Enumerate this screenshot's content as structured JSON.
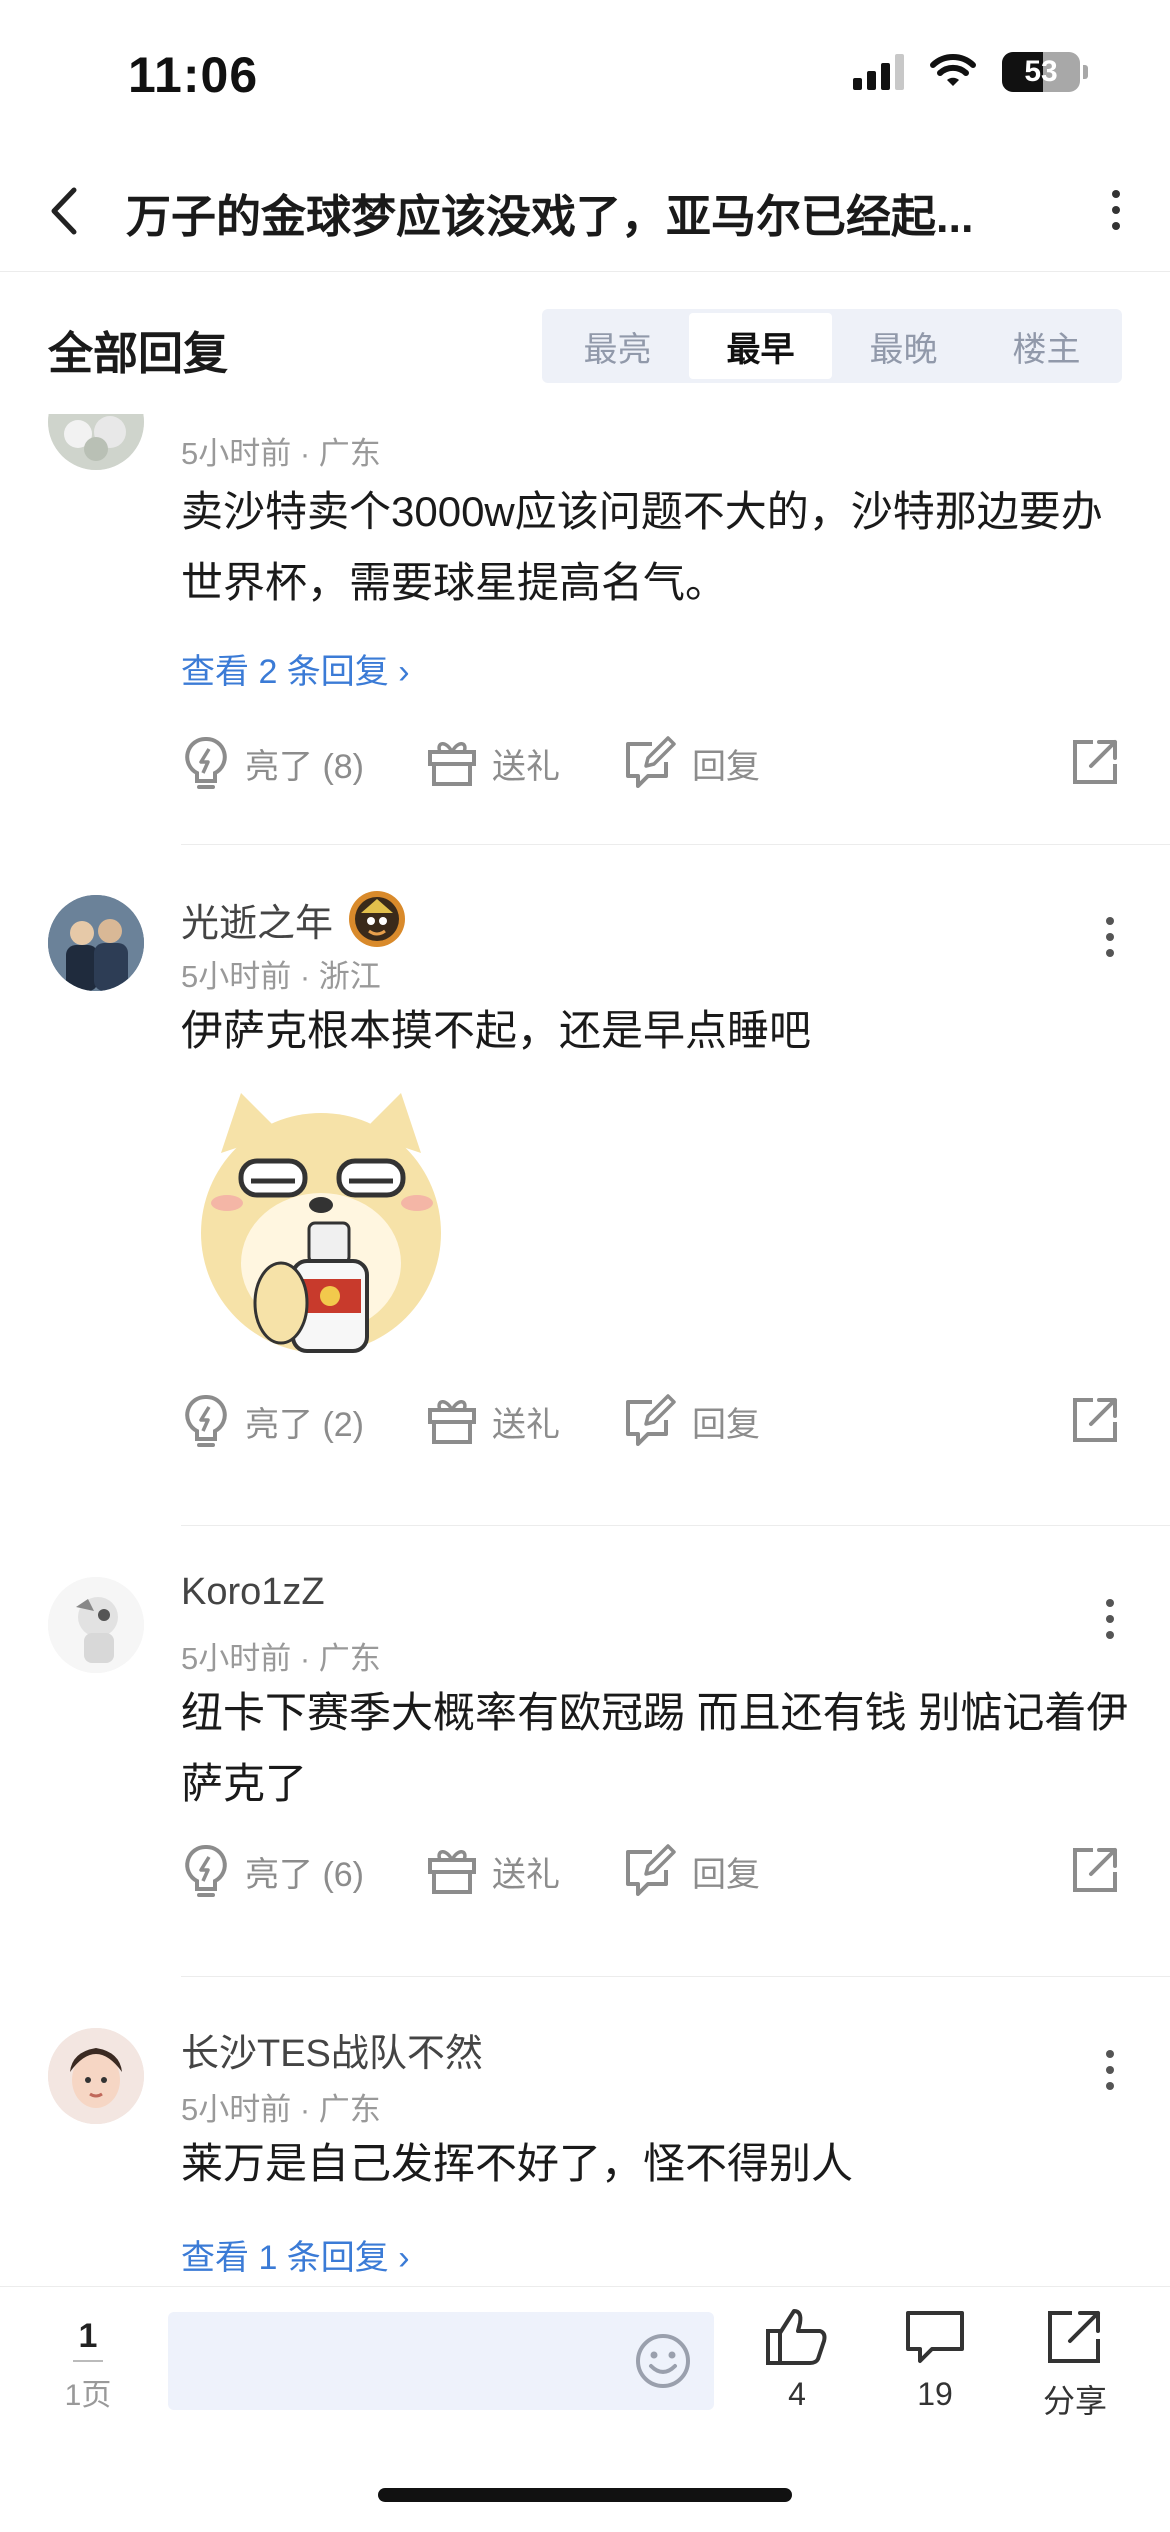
{
  "status_bar": {
    "time": "11:06",
    "battery": "53"
  },
  "title_bar": {
    "title": "万子的金球梦应该没戏了，亚马尔已经起..."
  },
  "sort_bar": {
    "label": "全部回复",
    "tabs": [
      {
        "label": "最亮",
        "active": false
      },
      {
        "label": "最早",
        "active": true
      },
      {
        "label": "最晚",
        "active": false
      },
      {
        "label": "楼主",
        "active": false
      }
    ]
  },
  "comments": [
    {
      "username": "",
      "meta": "5小时前 · 广东",
      "text": "卖沙特卖个3000w应该问题不大的，沙特那边要办世界杯，需要球星提高名气。",
      "replies": "查看 2 条回复 ›",
      "actions": {
        "light": "亮了 (8)",
        "gift": "送礼",
        "reply": "回复"
      }
    },
    {
      "username": "光逝之年",
      "meta": "5小时前 · 浙江",
      "text": "伊萨克根本摸不起，还是早点睡吧",
      "actions": {
        "light": "亮了 (2)",
        "gift": "送礼",
        "reply": "回复"
      }
    },
    {
      "username": "Koro1zZ",
      "meta": "5小时前 · 广东",
      "text": "纽卡下赛季大概率有欧冠踢 而且还有钱 别惦记着伊萨克了",
      "actions": {
        "light": "亮了 (6)",
        "gift": "送礼",
        "reply": "回复"
      }
    },
    {
      "username": "长沙TES战队不然",
      "meta": "5小时前 · 广东",
      "text": "莱万是自己发挥不好了，怪不得别人",
      "replies": "查看 1 条回复 ›"
    }
  ],
  "bottom_bar": {
    "page_num": "1",
    "page_total": "1页",
    "like_count": "4",
    "comment_count": "19",
    "share_label": "分享"
  },
  "colors": {
    "link": "#3b7bd6",
    "muted": "#8c8c8c",
    "tab_bg": "#eef1f8",
    "input_bg": "#eef2fb"
  }
}
